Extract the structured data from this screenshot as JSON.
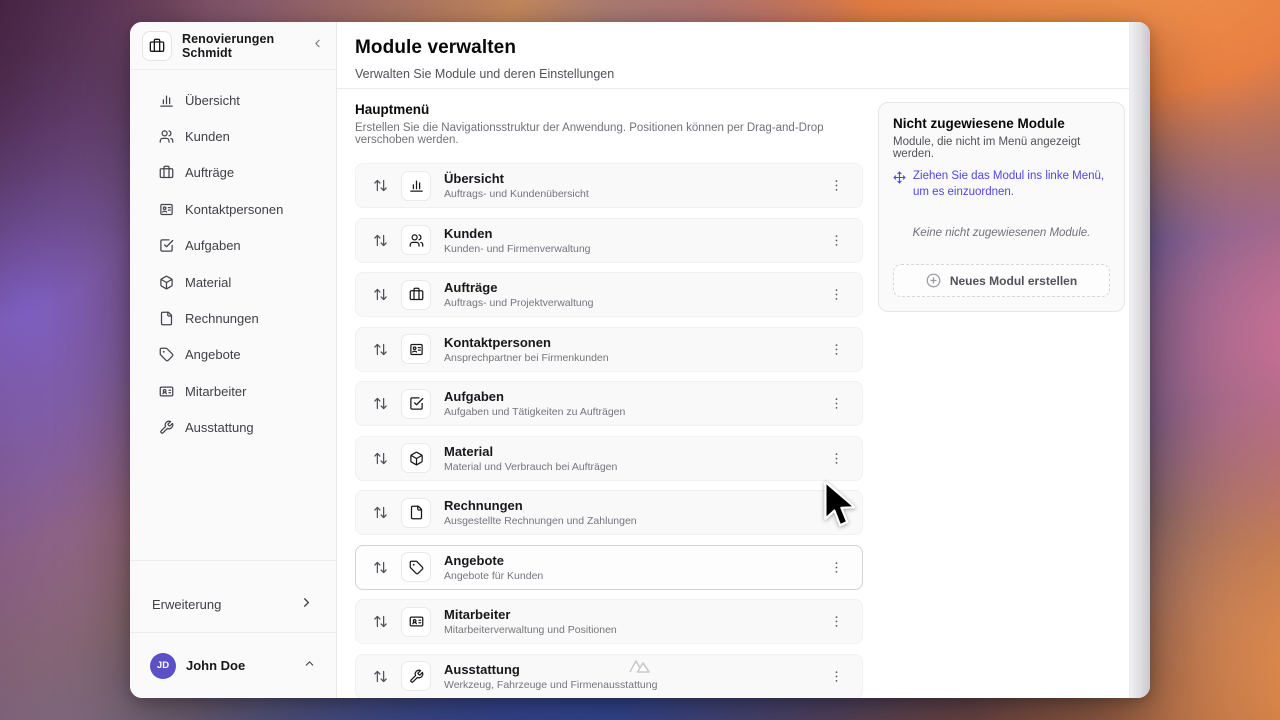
{
  "sidebar": {
    "workspace": "Renovierungen Schmidt",
    "workspace_icon": "briefcase-icon",
    "collapse_icon": "chevron-left-icon",
    "items": [
      {
        "label": "Übersicht",
        "icon": "bar-chart"
      },
      {
        "label": "Kunden",
        "icon": "users"
      },
      {
        "label": "Aufträge",
        "icon": "briefcase"
      },
      {
        "label": "Kontaktpersonen",
        "icon": "contact-card"
      },
      {
        "label": "Aufgaben",
        "icon": "check-square"
      },
      {
        "label": "Material",
        "icon": "box"
      },
      {
        "label": "Rechnungen",
        "icon": "file"
      },
      {
        "label": "Angebote",
        "icon": "tag"
      },
      {
        "label": "Mitarbeiter",
        "icon": "id-card"
      },
      {
        "label": "Ausstattung",
        "icon": "wrench"
      }
    ],
    "footer": {
      "extension_label": "Erweiterung",
      "user_name": "John Doe",
      "user_initials": "JD"
    }
  },
  "header": {
    "title": "Module verwalten",
    "subtitle": "Verwalten Sie Module und deren Einstellungen"
  },
  "main_menu": {
    "title": "Hauptmenü",
    "description": "Erstellen Sie die Navigationsstruktur der Anwendung. Positionen können per Drag-and-Drop verschoben werden.",
    "modules": [
      {
        "title": "Übersicht",
        "subtitle": "Auftrags- und Kundenübersicht",
        "icon": "bar-chart",
        "selected": false
      },
      {
        "title": "Kunden",
        "subtitle": "Kunden- und Firmenverwaltung",
        "icon": "users",
        "selected": false
      },
      {
        "title": "Aufträge",
        "subtitle": "Auftrags- und Projektverwaltung",
        "icon": "briefcase",
        "selected": false
      },
      {
        "title": "Kontaktpersonen",
        "subtitle": "Ansprechpartner bei Firmenkunden",
        "icon": "contact-card",
        "selected": false
      },
      {
        "title": "Aufgaben",
        "subtitle": "Aufgaben und Tätigkeiten zu Aufträgen",
        "icon": "check-square",
        "selected": false
      },
      {
        "title": "Material",
        "subtitle": "Material und Verbrauch bei Aufträgen",
        "icon": "box",
        "selected": false
      },
      {
        "title": "Rechnungen",
        "subtitle": "Ausgestellte Rechnungen und Zahlungen",
        "icon": "file",
        "selected": false
      },
      {
        "title": "Angebote",
        "subtitle": "Angebote für Kunden",
        "icon": "tag",
        "selected": true
      },
      {
        "title": "Mitarbeiter",
        "subtitle": "Mitarbeiterverwaltung und Positionen",
        "icon": "id-card",
        "selected": false
      },
      {
        "title": "Ausstattung",
        "subtitle": "Werkzeug, Fahrzeuge und Firmenausstattung",
        "icon": "wrench",
        "selected": false
      }
    ]
  },
  "unassigned_panel": {
    "title": "Nicht zugewiesene Module",
    "description": "Module, die nicht im Menü angezeigt werden.",
    "hint": "Ziehen Sie das Modul ins linke Menü, um es einzuordnen.",
    "hint_icon": "move-icon",
    "empty_text": "Keine nicht zugewiesenen Module.",
    "create_button": "Neues Modul erstellen",
    "create_button_icon": "plus-circle-icon"
  },
  "colors": {
    "accent": "#4f46e5",
    "avatar": "#5b50c5",
    "sidebar_bg": "#fafafa",
    "card_bg": "#f9f9fa",
    "selected_border": "#d2d2d8"
  }
}
